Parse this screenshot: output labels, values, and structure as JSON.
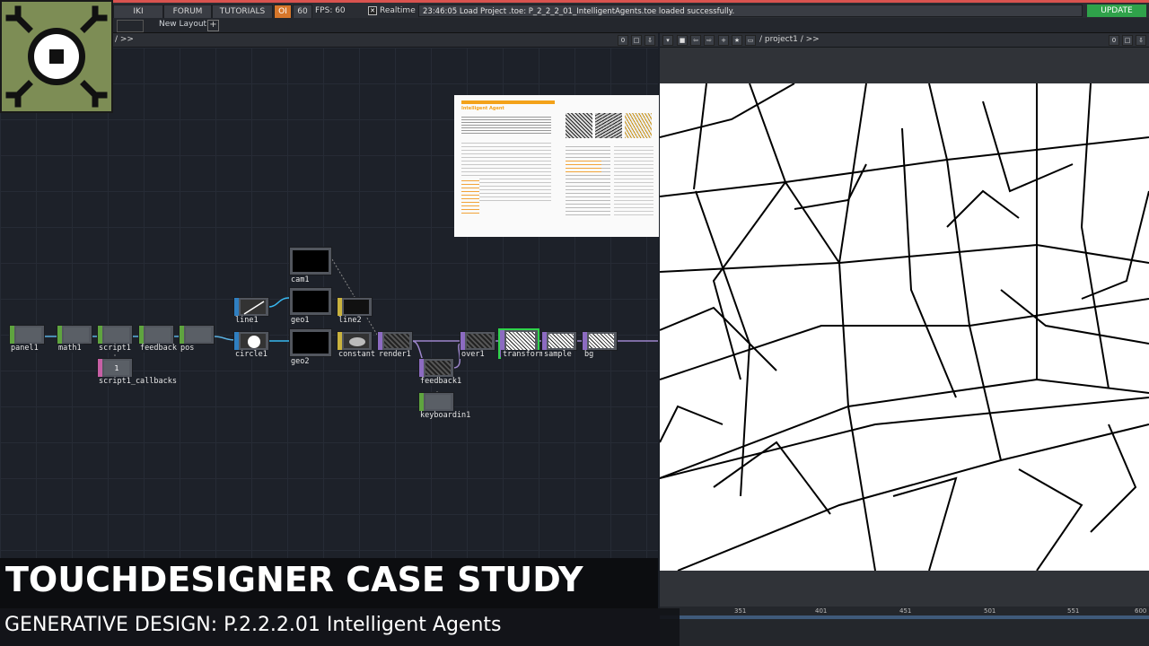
{
  "topbar": {
    "buttons": [
      "IKI",
      "FORUM",
      "TUTORIALS"
    ],
    "oi_badge": "OI",
    "fps_num": "60",
    "fps_label": "FPS: 60",
    "realtime_label": "Realtime",
    "log_message": "23:46:05 Load Project .toe: P_2_2_2_01_IntelligentAgents.toe loaded successfully.",
    "update_label": "UPDATE"
  },
  "layout_bar": {
    "new_layout": "New Layout",
    "add": "+"
  },
  "left_path": "/ >>",
  "right_path": "/ project1 / >>",
  "zoom_left": "0",
  "zoom_right": "0",
  "operators": [
    {
      "name": "panel1"
    },
    {
      "name": "math1"
    },
    {
      "name": "script1"
    },
    {
      "name": "feedback"
    },
    {
      "name": "pos"
    },
    {
      "name": "script1_callbacks"
    },
    {
      "name": "line1"
    },
    {
      "name": "circle1"
    },
    {
      "name": "cam1"
    },
    {
      "name": "geo1"
    },
    {
      "name": "geo2"
    },
    {
      "name": "line2"
    },
    {
      "name": "constant"
    },
    {
      "name": "render1"
    },
    {
      "name": "over1"
    },
    {
      "name": "transform"
    },
    {
      "name": "sample"
    },
    {
      "name": "bg"
    },
    {
      "name": "feedback1"
    },
    {
      "name": "keyboardin1"
    }
  ],
  "script1_callbacks_value": "1",
  "timeline_ticks": [
    "351",
    "401",
    "451",
    "501",
    "551",
    "600"
  ],
  "book": {
    "heading": "Intelligent Agent"
  },
  "banner": {
    "title": "TOUCHDESIGNER CASE STUDY",
    "subtitle": "GENERATIVE DESIGN: P.2.2.2.01 Intelligent  Agents"
  },
  "colors": {
    "accent_update": "#2fa24a",
    "logo_bg": "#7d8d55",
    "chop_green": "#5fa43f",
    "sop_blue": "#2f7fc1",
    "top_purple": "#8c6bc1",
    "mat_yellow": "#c9b23e",
    "dat_pink": "#c75fa5"
  }
}
